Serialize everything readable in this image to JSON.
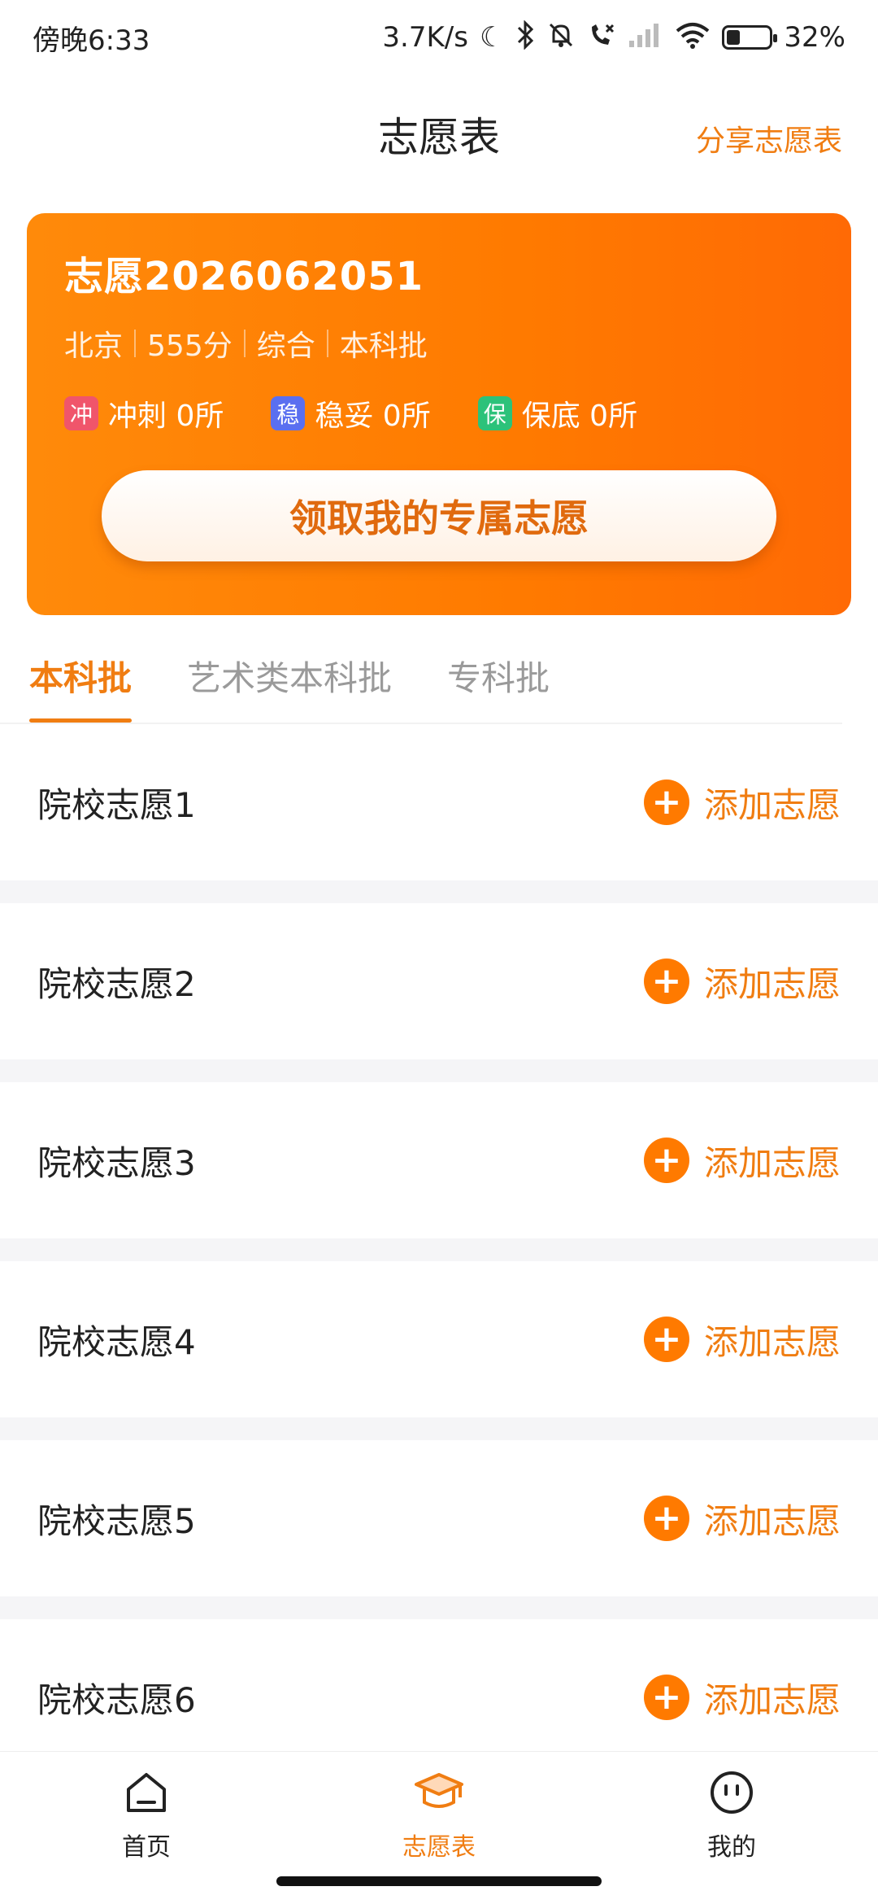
{
  "status_bar": {
    "time": "傍晚6:33",
    "network_speed": "3.7K/s",
    "battery_percent": "32%",
    "icons": [
      "moon-icon",
      "bluetooth-icon",
      "mute-icon",
      "missed-call-icon",
      "signal-icon",
      "wifi-icon",
      "battery-icon"
    ]
  },
  "header": {
    "title": "志愿表",
    "share_label": "分享志愿表"
  },
  "card": {
    "name": "志愿2026062051",
    "meta": [
      "北京",
      "555分",
      "综合",
      "本科批"
    ],
    "stats": [
      {
        "badge": "冲",
        "label": "冲刺 0所",
        "color": "#F0556B"
      },
      {
        "badge": "稳",
        "label": "稳妥 0所",
        "color": "#5A6FF0"
      },
      {
        "badge": "保",
        "label": "保底 0所",
        "color": "#2CC27A"
      }
    ],
    "claim_button": "领取我的专属志愿"
  },
  "tabs": [
    {
      "label": "本科批",
      "active": true
    },
    {
      "label": "艺术类本科批",
      "active": false
    },
    {
      "label": "专科批",
      "active": false
    }
  ],
  "list": {
    "add_label": "添加志愿",
    "items": [
      "院校志愿1",
      "院校志愿2",
      "院校志愿3",
      "院校志愿4",
      "院校志愿5",
      "院校志愿6"
    ]
  },
  "bottom_nav": [
    {
      "label": "首页",
      "icon": "home-icon",
      "active": false
    },
    {
      "label": "志愿表",
      "icon": "graduation-cap-icon",
      "active": true
    },
    {
      "label": "我的",
      "icon": "smiley-icon",
      "active": false
    }
  ],
  "colors": {
    "accent": "#F07D12",
    "card_gradient_start": "#FF8A0A",
    "card_gradient_end": "#FF6A05"
  }
}
